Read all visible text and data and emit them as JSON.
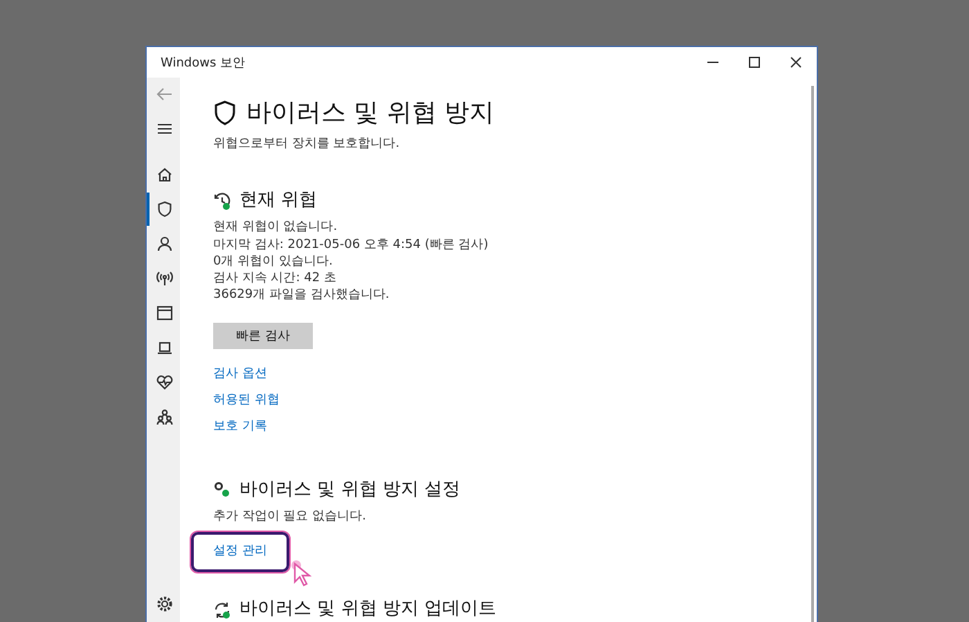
{
  "window": {
    "title": "Windows 보안"
  },
  "nav": {
    "top": [
      {
        "kind": "back",
        "selected": false
      },
      {
        "kind": "menu",
        "selected": false
      }
    ],
    "items": [
      {
        "kind": "home",
        "selected": false
      },
      {
        "kind": "shield",
        "selected": true
      },
      {
        "kind": "person",
        "selected": false
      },
      {
        "kind": "signal",
        "selected": false
      },
      {
        "kind": "window",
        "selected": false
      },
      {
        "kind": "laptop",
        "selected": false
      },
      {
        "kind": "heart",
        "selected": false
      },
      {
        "kind": "family",
        "selected": false
      }
    ],
    "bottom": [
      {
        "kind": "gear",
        "selected": false
      }
    ]
  },
  "page": {
    "title": "바이러스 및 위협 방지",
    "subtitle": "위협으로부터 장치를 보호합니다."
  },
  "sections": [
    {
      "kind": "threats",
      "title": "현재 위협",
      "lines": [
        "현재 위협이 없습니다.",
        "마지막 검사: 2021-05-06 오후 4:54 (빠른 검사)",
        "0개 위협이 있습니다.",
        "검사 지속 시간: 42 초",
        "36629개 파일을 검사했습니다."
      ],
      "button": "빠른 검사",
      "links": [
        {
          "label": "검사 옵션",
          "highlighted": false
        },
        {
          "label": "허용된 위협",
          "highlighted": false
        },
        {
          "label": "보호 기록",
          "highlighted": false
        }
      ]
    },
    {
      "kind": "settings",
      "title": "바이러스 및 위협 방지 설정",
      "lines": [
        "추가 작업이 필요 없습니다."
      ],
      "links": [
        {
          "label": "설정 관리",
          "highlighted": true
        }
      ]
    },
    {
      "kind": "update",
      "title": "바이러스 및 위협 방지 업데이트"
    }
  ]
}
